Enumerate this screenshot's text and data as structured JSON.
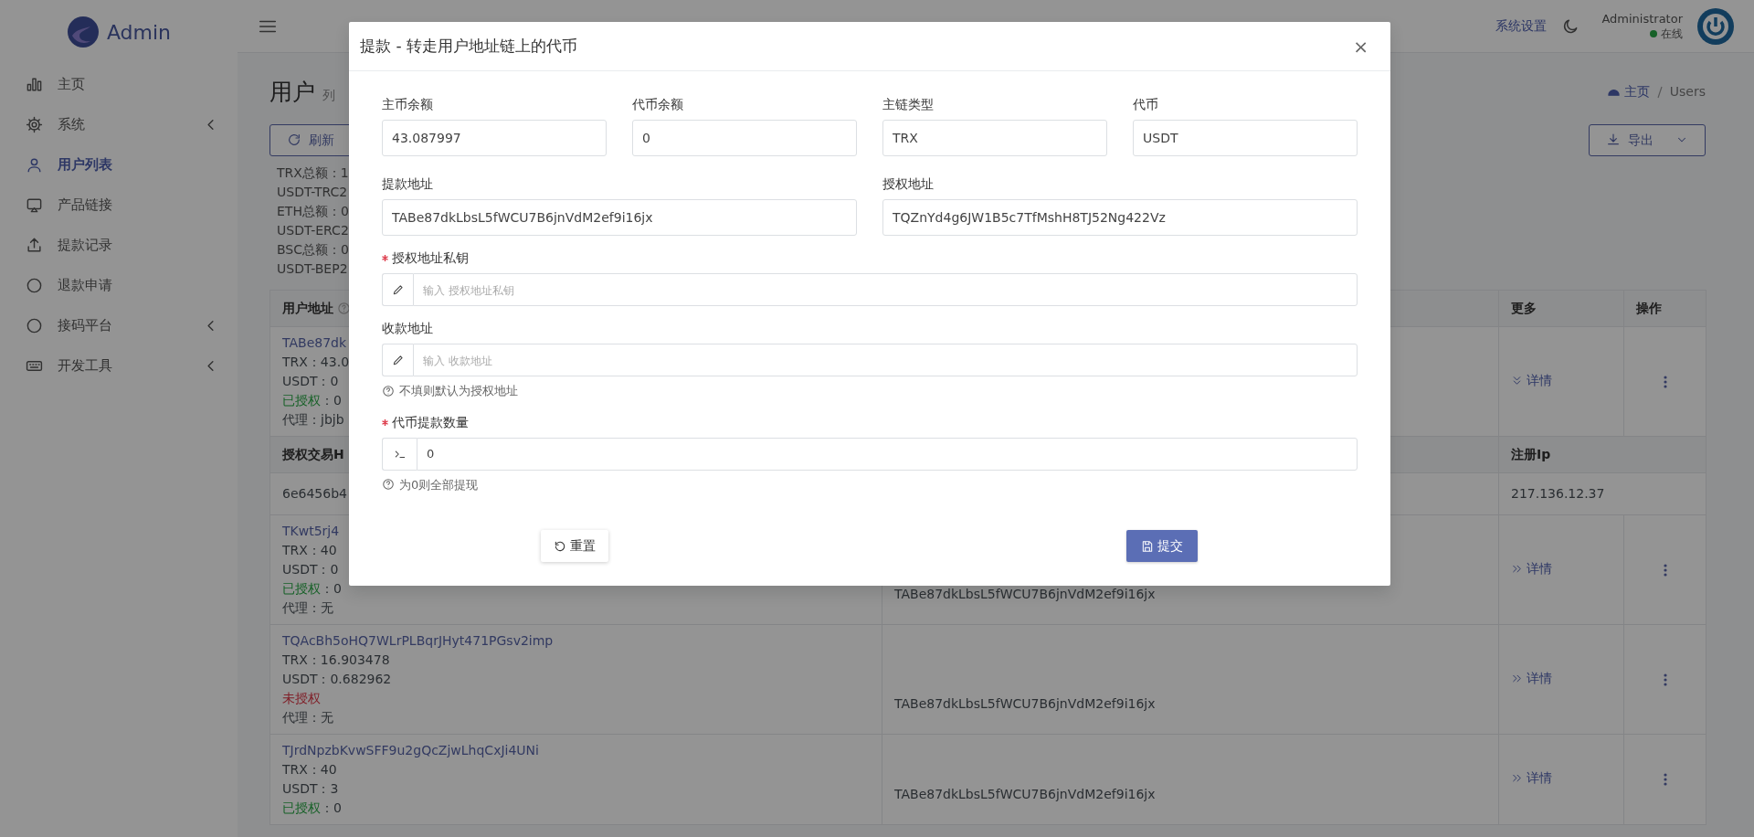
{
  "sidebar": {
    "brand": "Admin",
    "items": [
      {
        "label": "主页",
        "selected": false,
        "expandable": false
      },
      {
        "label": "系统",
        "selected": false,
        "expandable": true
      },
      {
        "label": "用户列表",
        "selected": true,
        "expandable": false
      },
      {
        "label": "产品链接",
        "selected": false,
        "expandable": false
      },
      {
        "label": "提款记录",
        "selected": false,
        "expandable": false
      },
      {
        "label": "退款申请",
        "selected": false,
        "expandable": false
      },
      {
        "label": "接码平台",
        "selected": false,
        "expandable": true
      },
      {
        "label": "开发工具",
        "selected": false,
        "expandable": true
      }
    ]
  },
  "header": {
    "settings": "系统设置",
    "user": "Administrator",
    "status": "在线"
  },
  "page": {
    "title": "用户",
    "subtitle": "列",
    "breadcrumb": [
      "主页",
      "Users"
    ],
    "refresh_button": "刷新",
    "export_button": "导出",
    "totals": [
      "TRX总额：1",
      "USDT-TRC2",
      "ETH总额：0",
      "USDT-ERC2",
      "BSC总额：0",
      "USDT-BEP2"
    ]
  },
  "table": {
    "columns": [
      {
        "label": "用户地址",
        "help": true
      },
      {
        "label": "更多",
        "help": false
      },
      {
        "label": "操作",
        "help": false
      }
    ],
    "rows": [
      {
        "kind": "user",
        "address": "TABe87dk",
        "trx": "TRX：43.0",
        "usdt": "USDT：0",
        "auth": {
          "authorized": true,
          "label": "已授权",
          "rest": "：0"
        },
        "agent": "代理：jbjb",
        "more": "详情",
        "expanded": true
      },
      {
        "kind": "detail",
        "headers": [
          "授权交易H",
          "注册Ip"
        ],
        "values": [
          "6e6456b4",
          "217.136.12.37"
        ]
      },
      {
        "kind": "user",
        "address": "TKwt5rj4",
        "trx": "TRX：40",
        "usdt": "USDT：0",
        "auth": {
          "authorized": true,
          "label": "已授权",
          "rest": "：0"
        },
        "agent": "代理：无",
        "column_2": "TABe87dkLbsL5fWCU7B6jnVdM2ef9i16jx",
        "more": "详情",
        "expanded": false
      },
      {
        "kind": "user",
        "address": "TQAcBh5oHQ7WLrPLBqrJHyt471PGsv2imp",
        "trx": "TRX：16.903478",
        "usdt": "USDT：0.682962",
        "auth": {
          "authorized": false,
          "label": "未授权"
        },
        "agent": "代理：无",
        "column_2": "TABe87dkLbsL5fWCU7B6jnVdM2ef9i16jx",
        "more": "详情",
        "expanded": false
      },
      {
        "kind": "user",
        "address": "TJrdNpzbKvwSFF9u2gQcZjwLhqCxJi4UNi",
        "trx": "TRX：40",
        "usdt": "USDT：3",
        "auth": {
          "authorized": true,
          "label": "已授权",
          "rest": "：0"
        },
        "column_2": "TABe87dkLbsL5fWCU7B6jnVdM2ef9i16jx",
        "more": "详情",
        "expanded": false
      }
    ]
  },
  "modal": {
    "title": "提款 - 转走用户地址链上的代币",
    "close": "×",
    "field_rows": [
      [
        {
          "kind": "readonly",
          "label": "主币余额",
          "value": "43.087997"
        },
        {
          "kind": "readonly",
          "label": "代币余额",
          "value": "0"
        },
        {
          "kind": "readonly",
          "label": "主链类型",
          "value": "TRX"
        },
        {
          "kind": "readonly",
          "label": "代币",
          "value": "USDT"
        }
      ],
      [
        {
          "kind": "readonly",
          "label": "提款地址",
          "value": "TABe87dkLbsL5fWCU7B6jnVdM2ef9i16jx"
        },
        {
          "kind": "readonly",
          "label": "授权地址",
          "value": "TQZnYd4g6JW1B5c7TfMshH8TJ52Ng422Vz"
        }
      ],
      [
        {
          "kind": "text",
          "label": "授权地址私钥",
          "required": true,
          "placeholder": "输入 授权地址私钥"
        }
      ],
      [
        {
          "kind": "text",
          "label": "收款地址",
          "required": false,
          "placeholder": "输入 收款地址",
          "help": "不填则默认为授权地址"
        }
      ],
      [
        {
          "kind": "number",
          "label": "代币提款数量",
          "required": true,
          "value": "0",
          "help": "为0则全部提现"
        }
      ]
    ],
    "buttons": [
      {
        "kind": "reset",
        "label": "重置"
      },
      {
        "kind": "submit",
        "label": "提交"
      }
    ]
  }
}
